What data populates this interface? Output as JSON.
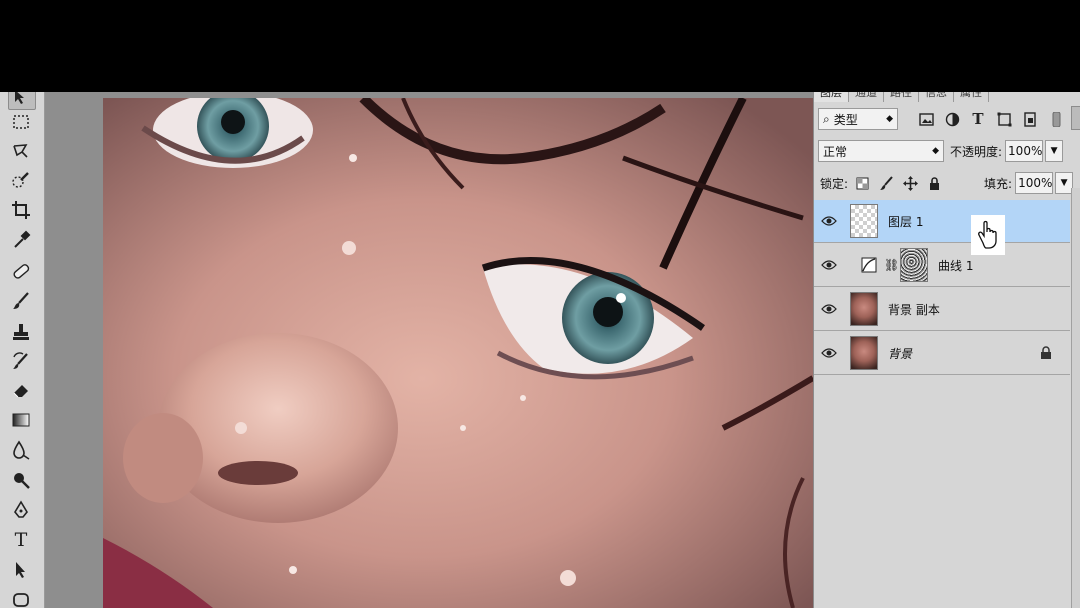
{
  "panel": {
    "tabs": [
      "图层",
      "通道",
      "路径",
      "信息",
      "属性"
    ],
    "filter_label": "类型",
    "blend_mode": "正常",
    "opacity_label": "不透明度:",
    "opacity_value": "100%",
    "lock_label": "锁定:",
    "fill_label": "填充:",
    "fill_value": "100%",
    "layers": [
      {
        "name": "图层 1",
        "thumb": "transparent",
        "selected": true
      },
      {
        "name": "曲线 1",
        "thumb": "curves-adjustment",
        "selected": false
      },
      {
        "name": "背景 副本",
        "thumb": "photo",
        "selected": false
      },
      {
        "name": "背景",
        "thumb": "photo",
        "selected": false,
        "locked": true
      }
    ]
  },
  "toolbar": {
    "tools": [
      "move-tool",
      "marquee-tool",
      "lasso-tool",
      "quick-selection-tool",
      "crop-tool",
      "eyedropper-tool",
      "spot-healing-tool",
      "brush-tool",
      "clone-stamp-tool",
      "history-brush-tool",
      "eraser-tool",
      "gradient-tool",
      "blur-tool",
      "dodge-tool",
      "pen-tool",
      "type-tool",
      "path-selection-tool",
      "shape-tool"
    ],
    "type_glyph": "T"
  },
  "colors": {
    "selected_layer": "#b3d5f7",
    "panel_bg": "#d6d6d6",
    "canvas_bg": "#8e8e8e"
  }
}
